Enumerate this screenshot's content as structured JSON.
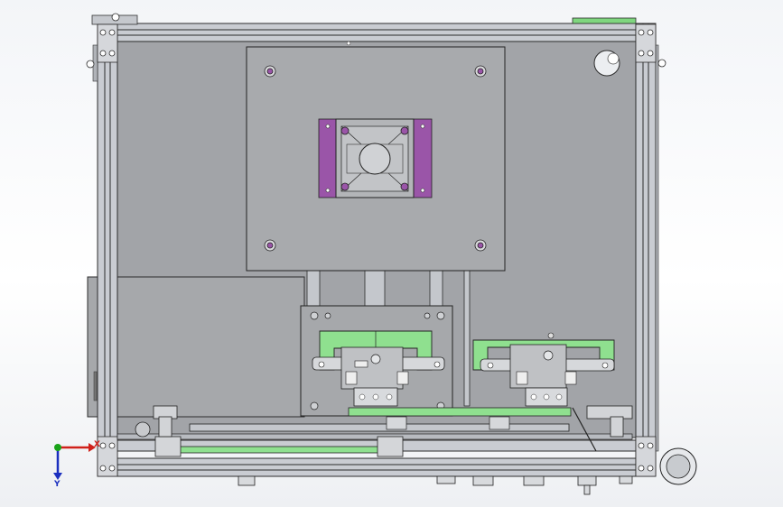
{
  "viewport": {
    "background": "#f6f7f9",
    "colors": {
      "frame": "#c9ccd2",
      "panel": "#a2a4a8",
      "plate": "#a8aaad",
      "green": "#8fe08f",
      "purple": "#9a55a8",
      "outline": "#2c2c2c"
    }
  },
  "triad": {
    "x_label": "X",
    "y_label": "Y",
    "x_color": "#d0201a",
    "y_color": "#1b2fbf",
    "origin_color": "#19a319"
  }
}
